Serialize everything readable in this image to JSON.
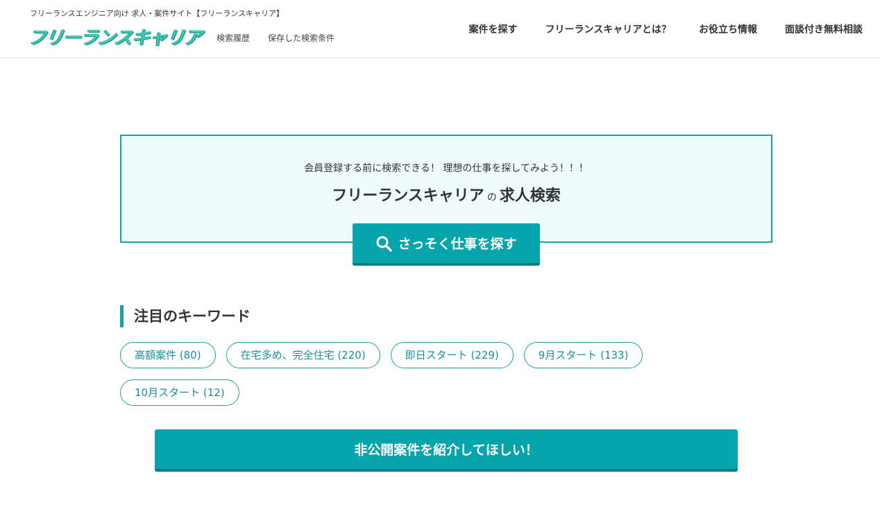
{
  "header": {
    "tagline": "フリーランスエンジニア向け 求人・案件サイト【フリーランスキャリア】",
    "logo_text": "フリーランスキャリア",
    "sublinks": [
      "検索履歴",
      "保存した検索条件"
    ],
    "nav": [
      "案件を探す",
      "フリーランスキャリアとは？",
      "お役立ち情報",
      "面談付き無料相談"
    ]
  },
  "search": {
    "subtitle": "会員登録する前に検索できる！ 理想の仕事を探してみよう！！！",
    "title_brand": "フリーランスキャリア",
    "title_particle": "の",
    "title_main": "求人検索",
    "button_label": "さっそく仕事を探す",
    "button_icon": "search-icon"
  },
  "keywords": {
    "heading": "注目のキーワード",
    "items": [
      "高額案件 (80)",
      "在宅多め、完全住宅 (220)",
      "即日スタート (229)",
      "9月スタート (133)",
      "10月スタート (12)"
    ]
  },
  "cta": {
    "label": "非公開案件を紹介してほしい！"
  },
  "colors": {
    "accent": "#06a4ac",
    "accent_dark": "#077d83",
    "box_bg": "#effcfd",
    "logo": "#3ec9b4"
  }
}
